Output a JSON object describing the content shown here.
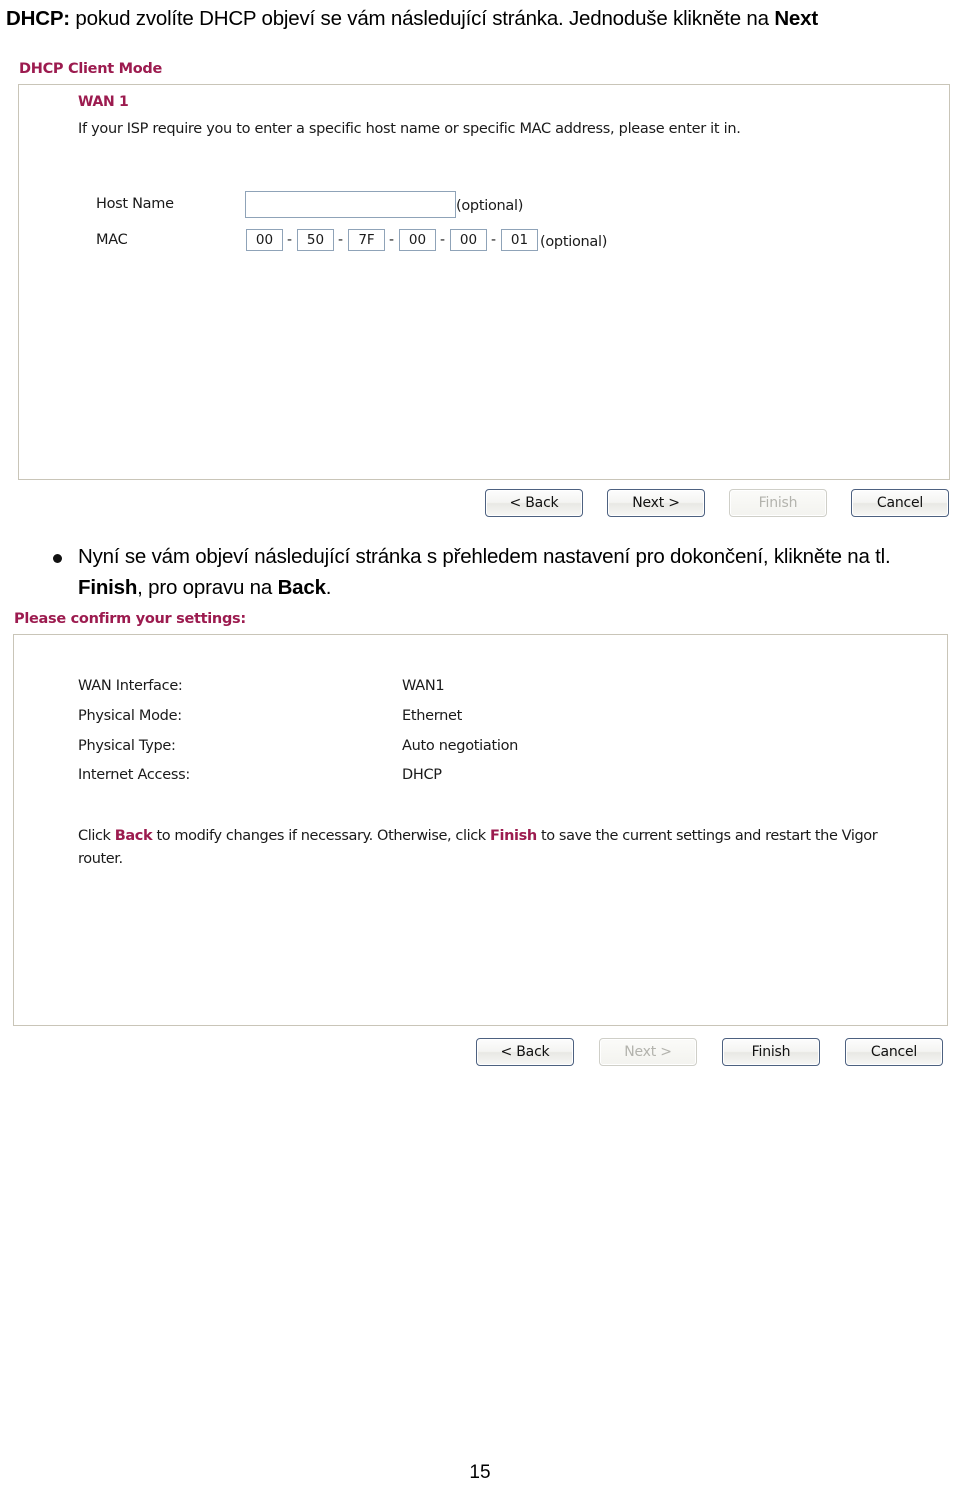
{
  "intro": {
    "lead": "DHCP:",
    "body": " pokud zvolíte DHCP objeví se vám následující stránka. Jednoduše klikněte na ",
    "emphasis": "Next"
  },
  "dhcp_panel": {
    "title": "DHCP Client Mode",
    "wan_label": "WAN 1",
    "description": "If your ISP require you to enter a specific host name or specific MAC address, please enter it in.",
    "host_name": {
      "label": "Host Name",
      "value": "",
      "placeholder": "",
      "optional_note": "(optional)"
    },
    "mac": {
      "label": "MAC",
      "octets": [
        "00",
        "50",
        "7F",
        "00",
        "00",
        "01"
      ],
      "separator": "-",
      "optional_note": "(optional)"
    },
    "buttons": [
      {
        "label": "< Back",
        "name": "back-button",
        "disabled": false
      },
      {
        "label": "Next >",
        "name": "next-button",
        "disabled": false
      },
      {
        "label": "Finish",
        "name": "finish-button",
        "disabled": true
      },
      {
        "label": "Cancel",
        "name": "cancel-button",
        "disabled": false
      }
    ]
  },
  "bullet": {
    "line1": "Nyní se vám objeví následující stránka s přehledem nastavení pro dokončení,",
    "line2_pre": "klikněte na tl. ",
    "line2_b1": "Finish",
    "line2_mid": ", pro opravu na ",
    "line2_b2": "Back",
    "line2_end": "."
  },
  "confirm_panel": {
    "title": "Please confirm your settings:",
    "rows": [
      {
        "label": "WAN Interface:",
        "value": "WAN1"
      },
      {
        "label": "Physical Mode:",
        "value": "Ethernet"
      },
      {
        "label": "Physical Type:",
        "value": "Auto negotiation"
      },
      {
        "label": "Internet Access:",
        "value": "DHCP"
      }
    ],
    "note": {
      "p1": "Click ",
      "b1": "Back",
      "p2": " to modify changes if necessary. Otherwise, click ",
      "b2": "Finish",
      "p3": " to save the current settings and restart the Vigor router."
    },
    "buttons": [
      {
        "label": "< Back",
        "name": "back-button",
        "disabled": false
      },
      {
        "label": "Next >",
        "name": "next-button",
        "disabled": true
      },
      {
        "label": "Finish",
        "name": "finish-button",
        "disabled": false
      },
      {
        "label": "Cancel",
        "name": "cancel-button",
        "disabled": false
      }
    ]
  },
  "footer": {
    "page_number": "15"
  },
  "colors": {
    "accent": "#9c1b4f",
    "panel_border": "#c9c5b8",
    "input_border": "#8fa3b8",
    "button_border": "#4d6180",
    "disabled_text": "#b3b3ad"
  }
}
